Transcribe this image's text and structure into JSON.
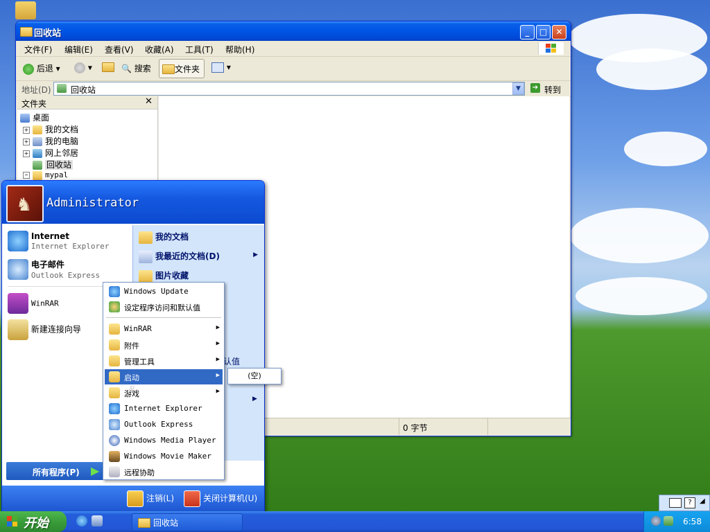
{
  "explorer": {
    "title": "回收站",
    "menu": [
      "文件(F)",
      "编辑(E)",
      "查看(V)",
      "收藏(A)",
      "工具(T)",
      "帮助(H)"
    ],
    "toolbar": {
      "back": "后退",
      "search": "搜索",
      "folders": "文件夹"
    },
    "address": {
      "label": "地址(D)",
      "value": "回收站",
      "go": "转到"
    },
    "folder_pane": {
      "title": "文件夹",
      "items": [
        "桌面",
        "我的文档",
        "我的电脑",
        "网上邻居",
        "回收站",
        "mypal"
      ]
    },
    "status": {
      "size": "0 字节"
    }
  },
  "start_menu": {
    "user": "Administrator",
    "pinned": [
      {
        "name": "Internet",
        "sub": "Internet Explorer"
      },
      {
        "name": "电子邮件",
        "sub": "Outlook Express"
      }
    ],
    "recent": [
      "WinRAR",
      "新建连接向导"
    ],
    "right_items": [
      "我的文档",
      "我最近的文档(D)",
      "图片收藏"
    ],
    "right_partial": "认值",
    "all_programs": "所有程序(P)",
    "logoff": "注销(L)",
    "shutdown": "关闭计算机(U)"
  },
  "programs_menu": {
    "items": [
      {
        "label": "Windows Update",
        "arrow": false
      },
      {
        "label": "设定程序访问和默认值",
        "arrow": false
      },
      {
        "label": "WinRAR",
        "arrow": true
      },
      {
        "label": "附件",
        "arrow": true
      },
      {
        "label": "管理工具",
        "arrow": true
      },
      {
        "label": "启动",
        "arrow": true,
        "highlighted": true
      },
      {
        "label": "游戏",
        "arrow": true
      },
      {
        "label": "Internet Explorer",
        "arrow": false
      },
      {
        "label": "Outlook Express",
        "arrow": false
      },
      {
        "label": "Windows Media Player",
        "arrow": false
      },
      {
        "label": "Windows Movie Maker",
        "arrow": false
      },
      {
        "label": "远程协助",
        "arrow": false
      }
    ],
    "startup_submenu": "(空)"
  },
  "taskbar": {
    "start": "开始",
    "task": "回收站",
    "clock": "6:58"
  },
  "colors": {
    "xp_blue": "#0055e5",
    "highlight": "#316ac5",
    "start_green": "#3a9d3a"
  }
}
